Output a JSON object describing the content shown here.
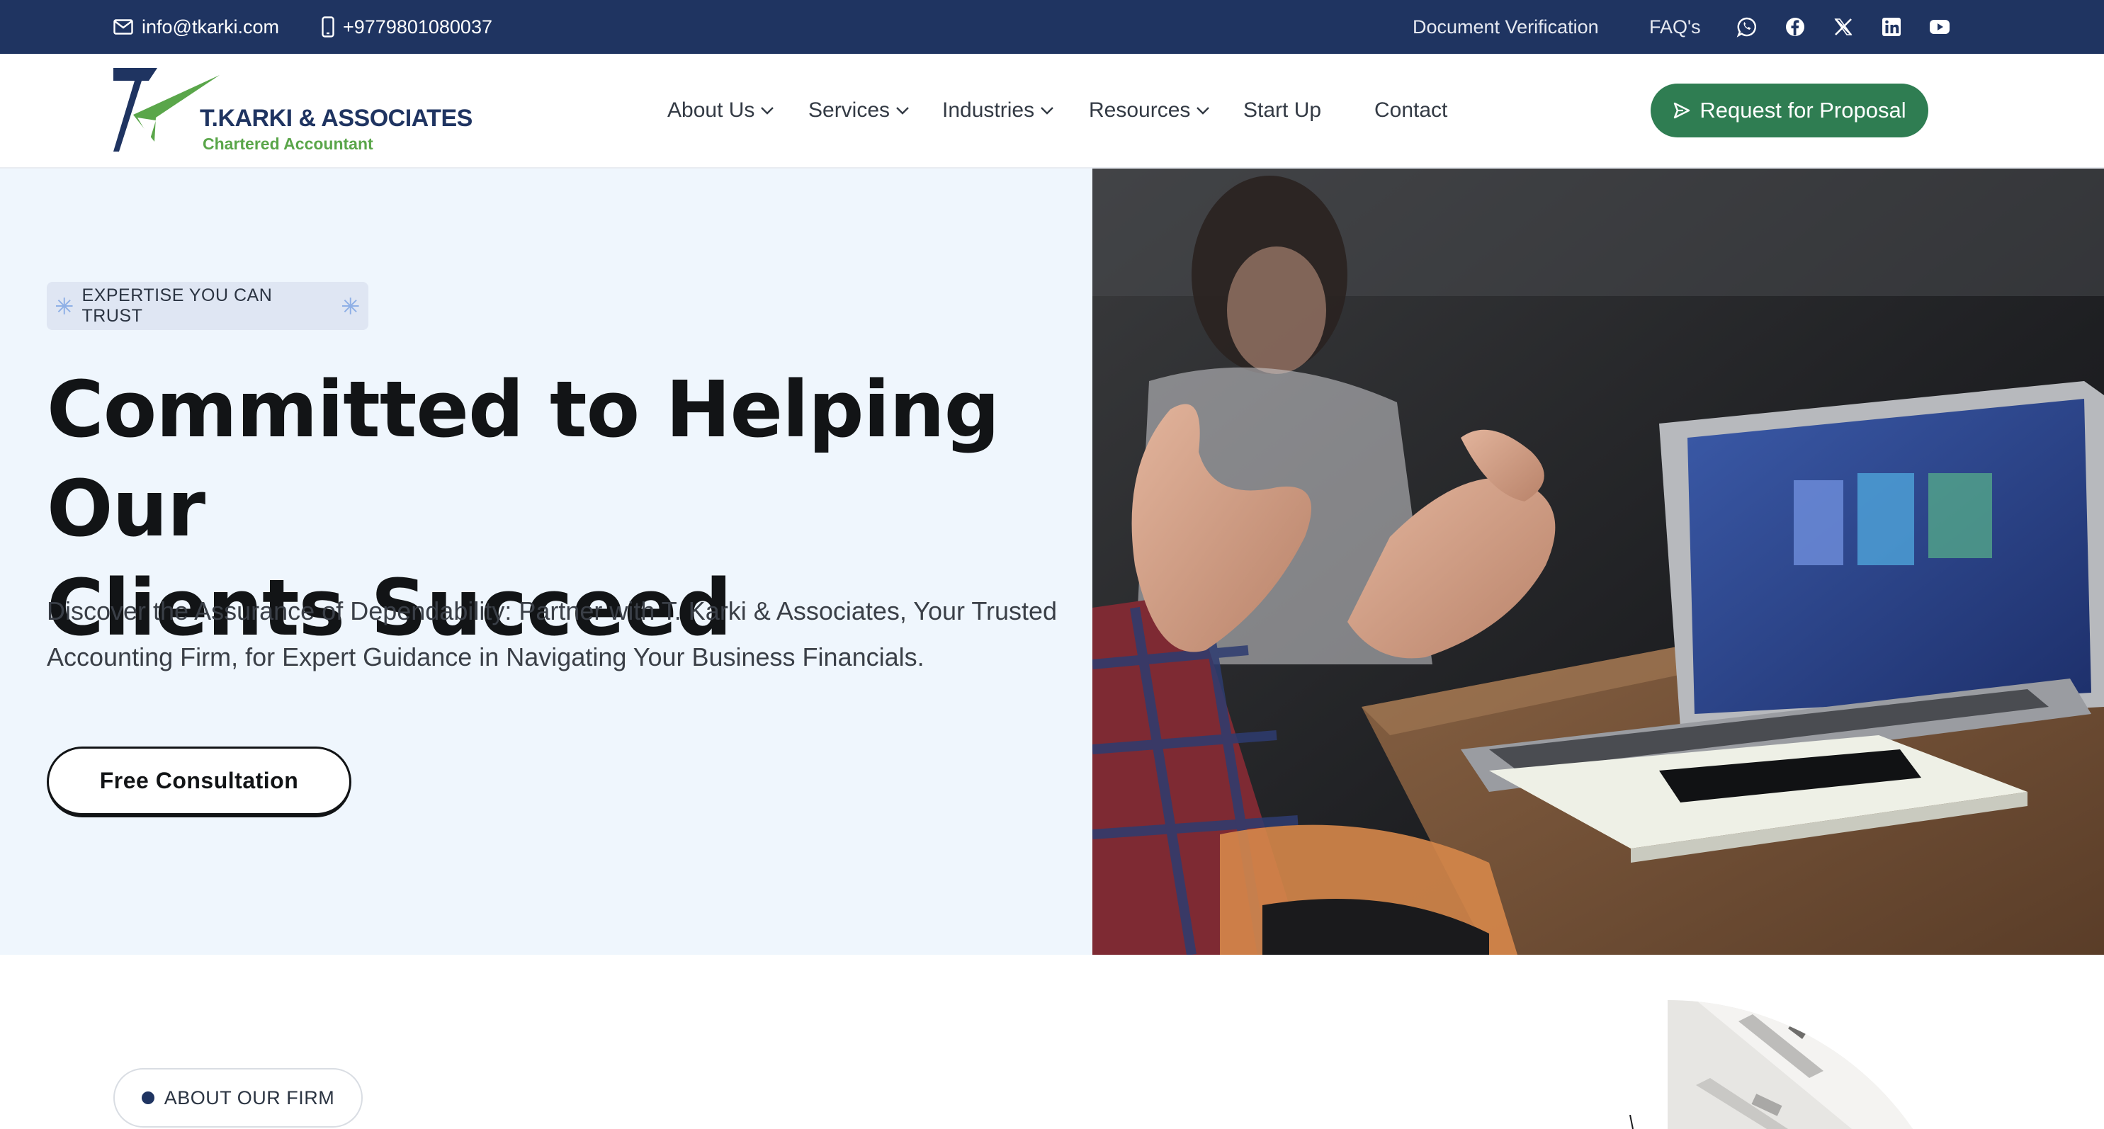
{
  "topbar": {
    "email": "info@tkarki.com",
    "phone": "+9779801080037",
    "document_verification": "Document Verification",
    "faqs": "FAQ's",
    "social": [
      "whatsapp-icon",
      "facebook-icon",
      "x-twitter-icon",
      "linkedin-icon",
      "youtube-icon"
    ]
  },
  "header": {
    "logo": {
      "name": "T.KARKI & ASSOCIATES",
      "subtitle": "Chartered Accountant"
    },
    "nav": [
      {
        "label": "About Us",
        "dropdown": true
      },
      {
        "label": "Services",
        "dropdown": true
      },
      {
        "label": "Industries",
        "dropdown": true
      },
      {
        "label": "Resources",
        "dropdown": true
      },
      {
        "label": "Start Up",
        "dropdown": false
      },
      {
        "label": "Contact",
        "dropdown": false
      }
    ],
    "cta_label": "Request for Proposal"
  },
  "hero": {
    "badge": "EXPERTISE YOU CAN TRUST",
    "title_line1": "Committed to Helping Our",
    "title_line2": "Clients Succeed",
    "description": "Discover the Assurance of Dependability: Partner with T. Karki & Associates, Your Trusted Accounting Firm, for Expert Guidance in Navigating Your Business Financials.",
    "button_label": "Free Consultation"
  },
  "about": {
    "pill_label": "ABOUT OUR FIRM"
  },
  "colors": {
    "topbar_bg": "#1f3461",
    "brand_navy": "#1f3461",
    "brand_green": "#5aa64a",
    "cta_green": "#2f7d52",
    "hero_bg": "#eff6fd"
  }
}
